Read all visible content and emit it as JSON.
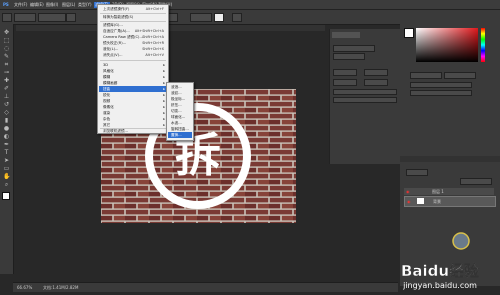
{
  "menubar": {
    "items": [
      "PS",
      "文件(F)",
      "编辑(E)",
      "图像(I)",
      "图层(L)",
      "类型(Y)",
      "选择(S)",
      "滤镜(T)",
      "3D(D)",
      "视图(V)",
      "窗口(W)",
      "帮助(H)"
    ]
  },
  "filter_menu": {
    "items": [
      {
        "label": "上次滤镜操作(F)",
        "shortcut": "Alt+Ctrl+F"
      },
      {
        "label": "转换为智能滤镜(S)",
        "shortcut": ""
      },
      {
        "label": "滤镜库(G)...",
        "shortcut": ""
      },
      {
        "label": "自适应广角(A)...",
        "shortcut": "Alt+Shift+Ctrl+A"
      },
      {
        "label": "Camera Raw 滤镜(C)...",
        "shortcut": "Shift+Ctrl+A"
      },
      {
        "label": "镜头校正(R)...",
        "shortcut": "Shift+Ctrl+R"
      },
      {
        "label": "液化(L)...",
        "shortcut": "Shift+Ctrl+X"
      },
      {
        "label": "消失点(V)...",
        "shortcut": "Alt+Ctrl+V"
      },
      {
        "label": "3D",
        "shortcut": ""
      },
      {
        "label": "风格化",
        "shortcut": ""
      },
      {
        "label": "模糊",
        "shortcut": ""
      },
      {
        "label": "模糊画廊",
        "shortcut": ""
      },
      {
        "label": "扭曲",
        "shortcut": ""
      },
      {
        "label": "锐化",
        "shortcut": ""
      },
      {
        "label": "视频",
        "shortcut": ""
      },
      {
        "label": "像素化",
        "shortcut": ""
      },
      {
        "label": "渲染",
        "shortcut": ""
      },
      {
        "label": "杂色",
        "shortcut": ""
      },
      {
        "label": "其它",
        "shortcut": ""
      },
      {
        "label": "浏览联机滤镜...",
        "shortcut": ""
      }
    ]
  },
  "distort_submenu": {
    "items": [
      "波浪...",
      "波纹...",
      "极坐标...",
      "挤压...",
      "切变...",
      "球面化...",
      "水波...",
      "旋转扭曲...",
      "置换..."
    ]
  },
  "canvas": {
    "stamp_char": "拆",
    "brick_color": "#7a3a34",
    "mortar_color": "#c9c2b8"
  },
  "color_panel": {
    "foreground": "#ffffff"
  },
  "layers": [
    {
      "name": "图层 1"
    },
    {
      "name": "背景"
    }
  ],
  "status": {
    "zoom": "66.67%",
    "doc": "文档:1.41M/2.82M"
  },
  "watermark": {
    "brand": "Baidu经验",
    "url": "jingyan.baidu.com"
  },
  "colors": {
    "menu_highlight": "#2f6fd0",
    "ui_dark": "#282828",
    "panel": "#3a3a3a"
  }
}
